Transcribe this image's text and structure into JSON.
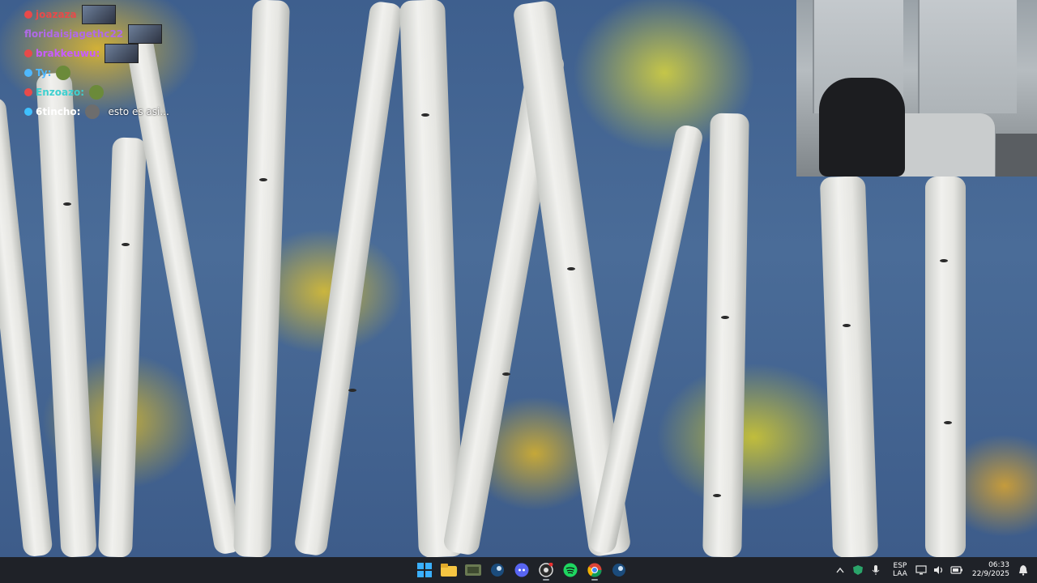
{
  "chat": [
    {
      "name": "joazaza",
      "color": "#e84a4a",
      "dot": "#e84a4a",
      "avatar": true,
      "emote": false,
      "message": ""
    },
    {
      "name": "floridaisjagethc22",
      "color": "#b06ae8",
      "dot": "",
      "avatar": true,
      "emote": false,
      "message": ""
    },
    {
      "name": "brakkeuwu:",
      "color": "#c85cff",
      "dot": "#e84a4a",
      "avatar": true,
      "emote": false,
      "message": ""
    },
    {
      "name": "Ty:",
      "color": "#4fb8ff",
      "dot": "#4fb8ff",
      "avatar": false,
      "emote": true,
      "message": ""
    },
    {
      "name": "Enzoazo:",
      "color": "#3ed0d0",
      "dot": "#e84a4a",
      "avatar": false,
      "emote": true,
      "message": ""
    },
    {
      "name": "6tincho:",
      "color": "#ffffff",
      "dot": "#3ec0ff",
      "avatar": false,
      "emote": true,
      "message": "esto es asi..."
    }
  ],
  "taskbar": {
    "apps": [
      {
        "name": "windows-start",
        "icon": "windows-icon",
        "active": false
      },
      {
        "name": "file-explorer",
        "icon": "folder-icon",
        "active": false
      },
      {
        "name": "game-app",
        "icon": "game-icon",
        "active": false
      },
      {
        "name": "steam-app",
        "icon": "steam-icon",
        "active": false
      },
      {
        "name": "discord-app",
        "icon": "discord-icon",
        "active": false
      },
      {
        "name": "obs-app",
        "icon": "obs-icon",
        "active": true
      },
      {
        "name": "spotify-app",
        "icon": "spotify-icon",
        "active": false
      },
      {
        "name": "chrome-app",
        "icon": "chrome-icon",
        "active": true
      },
      {
        "name": "steam-app-2",
        "icon": "steam-icon",
        "active": false
      }
    ],
    "tray": {
      "lang_top": "ESP",
      "lang_bottom": "LAA",
      "time": "06:33",
      "date": "22/9/2025"
    }
  },
  "colors": {
    "taskbar_bg": "#1f2228",
    "accent": "#0a84ff"
  }
}
